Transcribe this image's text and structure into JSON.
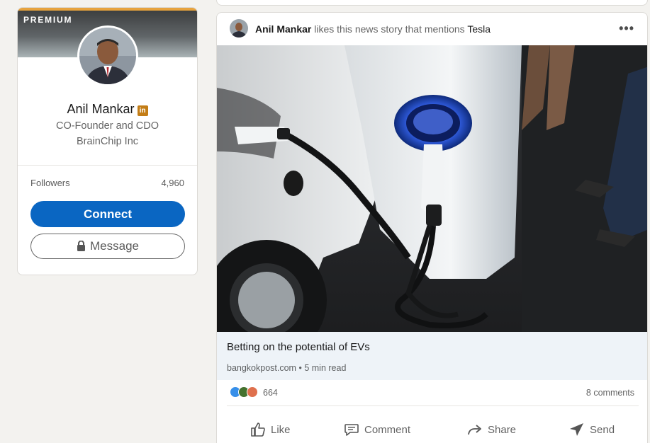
{
  "profile": {
    "premium_label": "PREMIUM",
    "name": "Anil Mankar",
    "badge": "in",
    "headline": "CO-Founder and CDO",
    "company": "BrainChip Inc",
    "followers_label": "Followers",
    "followers_count": "4,960",
    "connect_label": "Connect",
    "message_label": "Message"
  },
  "post": {
    "actor_name": "Anil Mankar",
    "action_text": "likes this news story that mentions",
    "mentioned": "Tesla",
    "article": {
      "title": "Betting on the potential of EVs",
      "source": "bangkokpost.com",
      "separator": "•",
      "read_time": "5 min read"
    },
    "reaction_count": "664",
    "comments_count": "8 comments",
    "actions": [
      {
        "label": "Like",
        "icon": "thumbs-up-icon"
      },
      {
        "label": "Comment",
        "icon": "comment-icon"
      },
      {
        "label": "Share",
        "icon": "share-arrow-icon"
      },
      {
        "label": "Send",
        "icon": "send-icon"
      }
    ]
  },
  "colors": {
    "accent": "#0a66c2",
    "premium": "#e7a33e",
    "badge": "#c37d16",
    "charger_glow": "#3b6cff"
  }
}
